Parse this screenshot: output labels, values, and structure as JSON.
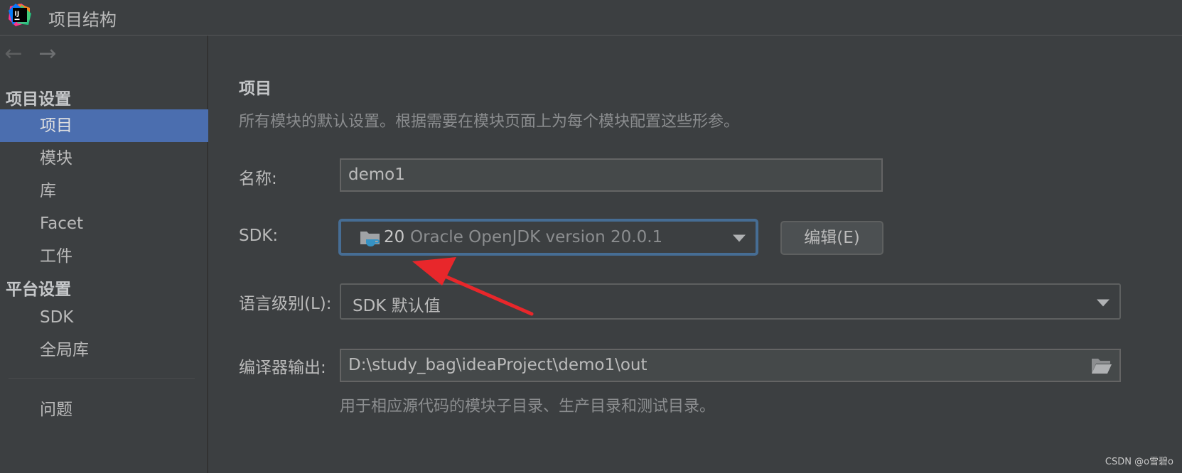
{
  "window": {
    "title": "项目结构",
    "logo_text": "IJ"
  },
  "sidebar": {
    "project_settings_header": "项目设置",
    "platform_settings_header": "平台设置",
    "items": [
      {
        "label": "项目",
        "selected": true
      },
      {
        "label": "模块"
      },
      {
        "label": "库"
      },
      {
        "label": "Facet"
      },
      {
        "label": "工件"
      }
    ],
    "platform_items": [
      {
        "label": "SDK"
      },
      {
        "label": "全局库"
      }
    ],
    "problems_label": "问题"
  },
  "main": {
    "heading": "项目",
    "description": "所有模块的默认设置。根据需要在模块页面上为每个模块配置这些形参。",
    "name_label": "名称:",
    "name_value": "demo1",
    "sdk_label": "SDK:",
    "sdk_version": "20",
    "sdk_detail": "Oracle OpenJDK version 20.0.1",
    "edit_button": "编辑(E)",
    "language_level_label": "语言级别(L):",
    "language_level_value": "SDK 默认值",
    "compiler_output_label": "编译器输出:",
    "compiler_output_value": "D:\\study_bag\\ideaProject\\demo1\\out",
    "compiler_output_hint": "用于相应源代码的模块子目录、生产目录和测试目录。"
  },
  "watermark": "CSDN @o雪碧o",
  "colors": {
    "selection": "#4b6eaf",
    "focus_border": "#466d94",
    "annotation_arrow": "#e8272b"
  }
}
